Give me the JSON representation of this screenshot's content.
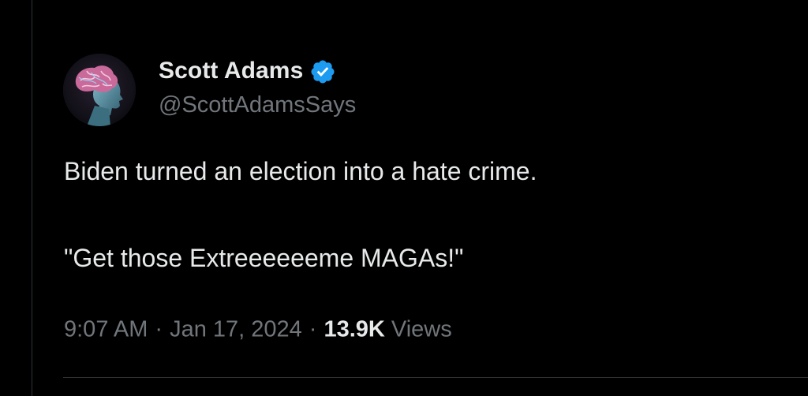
{
  "author": {
    "display_name": "Scott Adams",
    "handle": "@ScottAdamsSays",
    "verified_icon": "verified-badge-icon",
    "avatar_icon": "brain-head-avatar"
  },
  "tweet": {
    "lines": [
      "Biden turned an election into a hate crime.",
      "\"Get those Extreeeeeeme MAGAs!\""
    ]
  },
  "meta": {
    "time": "9:07 AM",
    "separator": "·",
    "date": "Jan 17, 2024",
    "views_count": "13.9K",
    "views_label": "Views"
  },
  "colors": {
    "background": "#000000",
    "primary_text": "#e7e9ea",
    "secondary_text": "#71767b",
    "verified_blue": "#1d9bf0",
    "divider": "#2f3336"
  }
}
